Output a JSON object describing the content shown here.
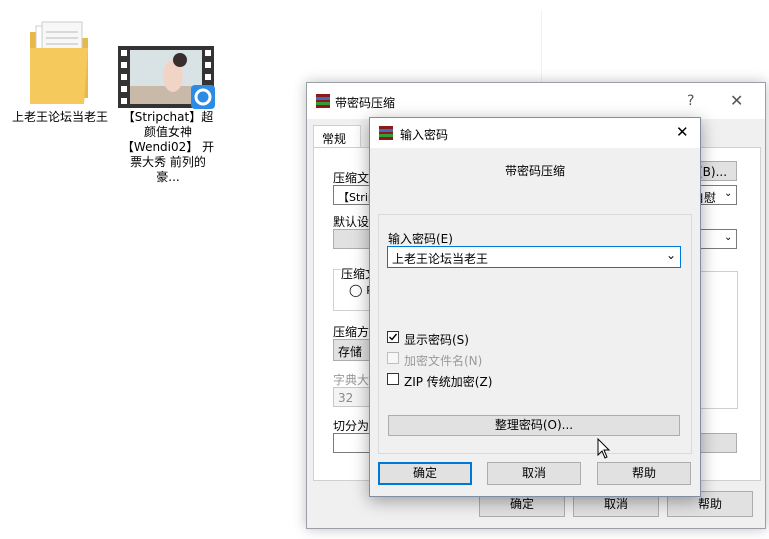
{
  "desktop": {
    "folder_label": "上老王论坛当老王",
    "video_label": "【Stripchat】超颜值女神【Wendi02】 开票大秀 前列的豪..."
  },
  "back_window": {
    "title": "带密码压缩",
    "help_glyph": "?",
    "close_glyph": "✕",
    "tab_general": "常规",
    "archive_name_label": "压缩文",
    "archive_name_value": "【Strip",
    "browse_button": "(B)...",
    "update_combo": "自慰",
    "default_settings_label": "默认设",
    "archive_format_label": "压缩文",
    "radio_glyph": "◯",
    "radio_text": "R",
    "compression_method_label": "压缩方",
    "compression_method_value": "存储",
    "dict_size_label": "字典大",
    "dict_size_value": "32",
    "split_label": "切分为",
    "ok_button": "确定",
    "cancel_button": "取消",
    "help_button": "帮助"
  },
  "dialog": {
    "title": "输入密码",
    "close_glyph": "✕",
    "subtitle": "带密码压缩",
    "password_label": "输入密码(E)",
    "password_value": "上老王论坛当老王",
    "show_password_label": "显示密码(S)",
    "show_password_checked": true,
    "encrypt_filenames_label": "加密文件名(N)",
    "zip_legacy_label": "ZIP 传统加密(Z)",
    "organize_button": "整理密码(O)...",
    "ok_button": "确定",
    "cancel_button": "取消",
    "help_button": "帮助"
  }
}
